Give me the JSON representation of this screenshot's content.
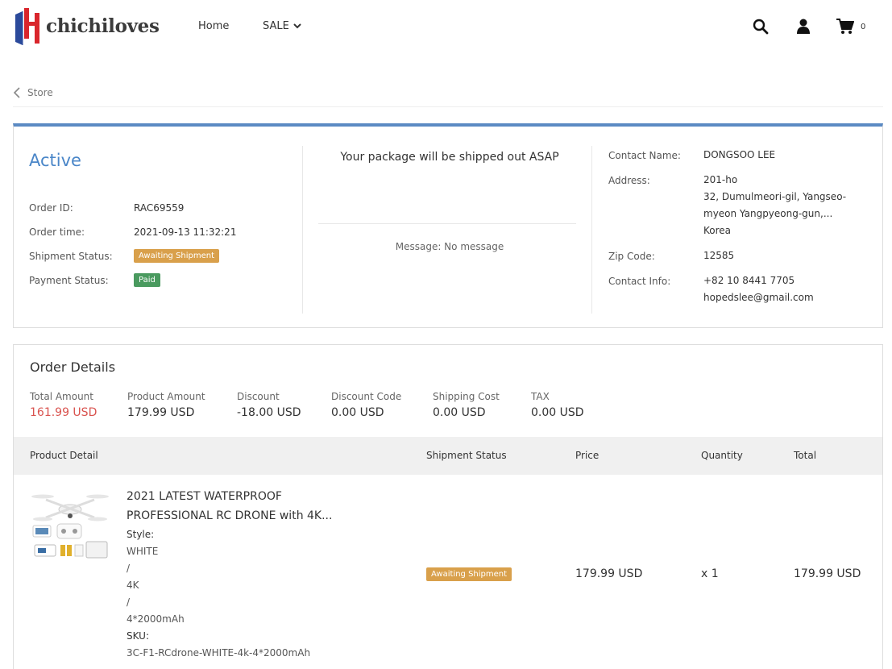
{
  "brand": {
    "name": "chichiloves"
  },
  "nav": {
    "home": "Home",
    "sale": "SALE",
    "cart_count": "0"
  },
  "breadcrumb": {
    "back_label": "Store"
  },
  "summary": {
    "status": "Active",
    "order_id_label": "Order ID:",
    "order_id": "RAC69559",
    "order_time_label": "Order time:",
    "order_time": "2021-09-13 11:32:21",
    "shipment_status_label": "Shipment Status:",
    "shipment_status": "Awaiting Shipment",
    "payment_status_label": "Payment Status:",
    "payment_status": "Paid",
    "ship_message": "Your package will be shipped out ASAP",
    "message_note": "Message: No message",
    "contact_name_label": "Contact Name:",
    "contact_name": "DONGSOO LEE",
    "address_label": "Address:",
    "address_line1": "201-ho",
    "address_line2": "32, Dumulmeori-gil, Yangseo-",
    "address_line3": "myeon Yangpyeong-gun,...",
    "address_line4": "Korea",
    "zip_label": "Zip Code:",
    "zip": "12585",
    "contact_info_label": "Contact Info:",
    "phone": "+82 10 8441 7705",
    "email": "hopedslee@gmail.com"
  },
  "details": {
    "title": "Order Details",
    "amounts": [
      {
        "label": "Total Amount",
        "value": "161.99 USD"
      },
      {
        "label": "Product Amount",
        "value": "179.99 USD"
      },
      {
        "label": "Discount",
        "value": "-18.00 USD"
      },
      {
        "label": "Discount Code",
        "value": "0.00 USD"
      },
      {
        "label": "Shipping Cost",
        "value": "0.00 USD"
      },
      {
        "label": "TAX",
        "value": "0.00 USD"
      }
    ],
    "columns": [
      "Product Detail",
      "Shipment Status",
      "Price",
      "Quantity",
      "Total"
    ],
    "item": {
      "title_line1": "2021 LATEST WATERPROOF",
      "title_line2": "PROFESSIONAL RC DRONE with 4K...",
      "style_label": "Style:",
      "style_color": "WHITE",
      "sep": "/",
      "style_res": "4K",
      "style_battery": "4*2000mAh",
      "sku_label": "SKU:",
      "sku": "3C-F1-RCdrone-WHITE-4k-4*2000mAh",
      "shipment_status": "Awaiting Shipment",
      "price": "179.99 USD",
      "quantity": "x 1",
      "total": "179.99 USD"
    }
  },
  "colors": {
    "accent": "#4a86c8",
    "top_border": "#5b8ac3",
    "badge_orange": "#d9a04b",
    "badge_green": "#4a9a5f",
    "total_red": "#d9534f"
  }
}
